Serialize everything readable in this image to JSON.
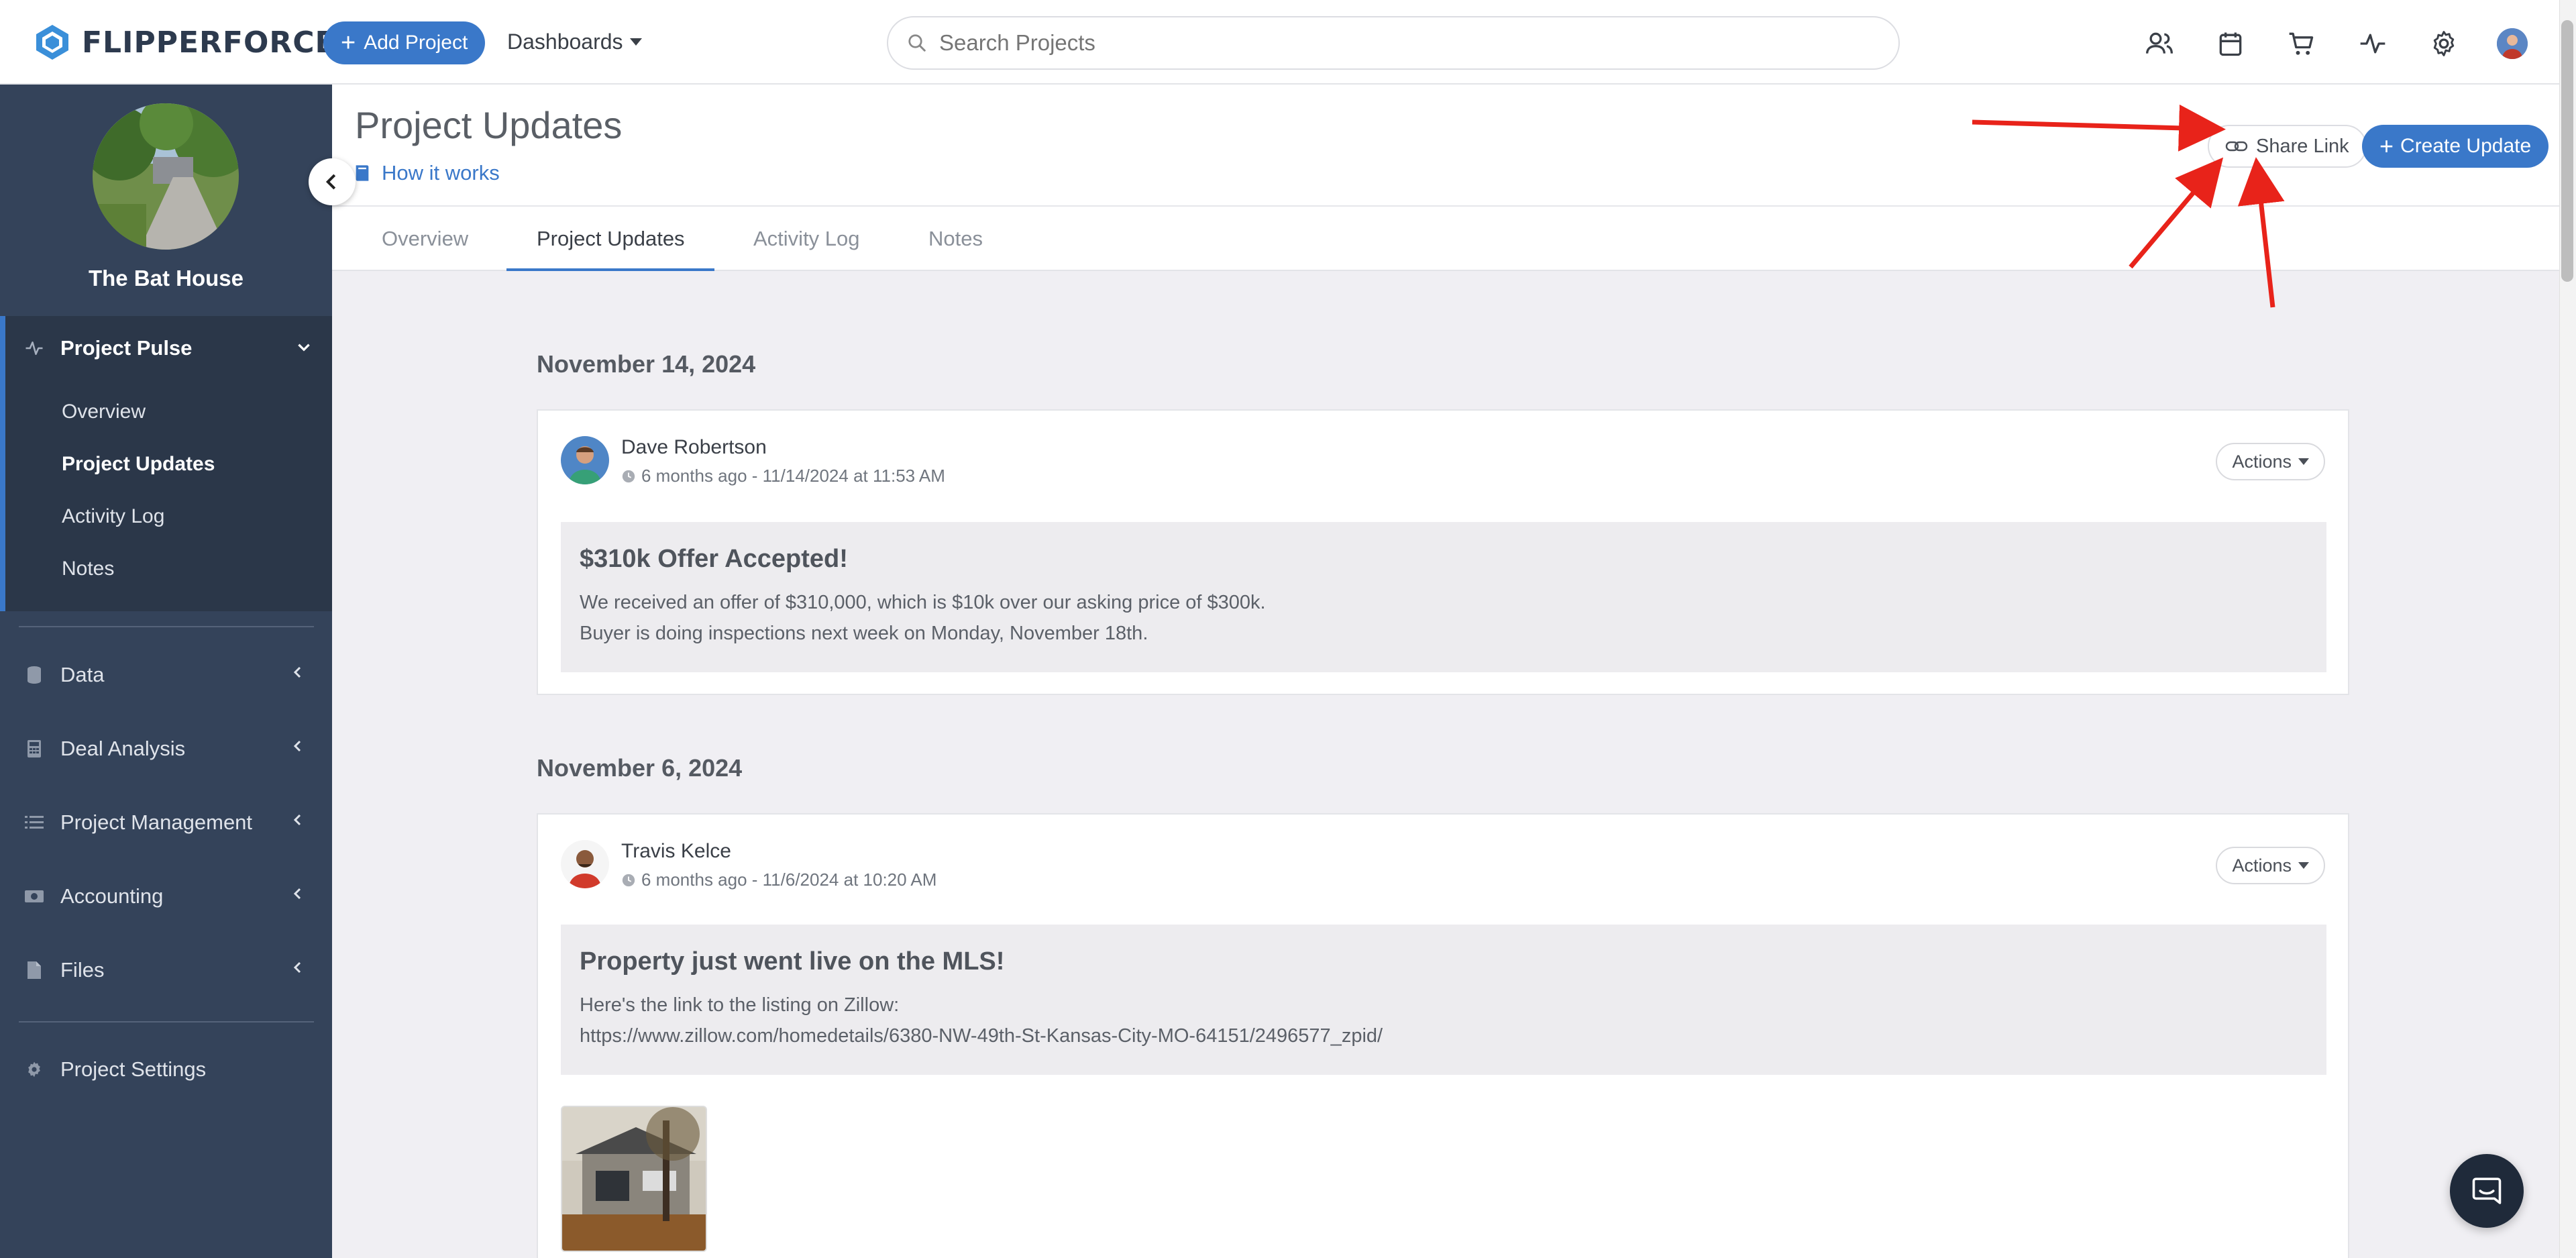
{
  "topbar": {
    "logo_text": "FLIPPERFORCE",
    "add_project_label": "Add Project",
    "dashboards_label": "Dashboards",
    "search_placeholder": "Search Projects",
    "icons": [
      "users-icon",
      "calendar-icon",
      "cart-icon",
      "pulse-icon",
      "gear-icon",
      "user-avatar"
    ]
  },
  "sidebar": {
    "project_name": "The Bat House",
    "pulse": {
      "label": "Project Pulse",
      "items": [
        "Overview",
        "Project Updates",
        "Activity Log",
        "Notes"
      ],
      "active": "Project Updates"
    },
    "sections": [
      {
        "label": "Data",
        "icon": "database-icon"
      },
      {
        "label": "Deal Analysis",
        "icon": "calculator-icon"
      },
      {
        "label": "Project Management",
        "icon": "list-icon"
      },
      {
        "label": "Accounting",
        "icon": "money-icon"
      },
      {
        "label": "Files",
        "icon": "file-icon"
      }
    ],
    "settings_label": "Project Settings"
  },
  "header": {
    "title": "Project Updates",
    "how_it_works": "How it works",
    "share_link_label": "Share Link",
    "create_update_label": "Create Update"
  },
  "tabs": [
    {
      "label": "Overview"
    },
    {
      "label": "Project Updates",
      "active": true
    },
    {
      "label": "Activity Log"
    },
    {
      "label": "Notes"
    }
  ],
  "updates": [
    {
      "date": "November 14, 2024",
      "author": "Dave Robertson",
      "meta": "6 months ago - 11/14/2024 at 11:53 AM",
      "actions_label": "Actions",
      "title": "$310k Offer Accepted!",
      "lines": [
        "We received an offer of $310,000, which is $10k over our asking price of $300k.",
        "Buyer is doing inspections next week on Monday, November 18th."
      ]
    },
    {
      "date": "November 6, 2024",
      "author": "Travis Kelce",
      "meta": "6 months ago - 11/6/2024 at 10:20 AM",
      "actions_label": "Actions",
      "title": "Property just went live on the MLS!",
      "lines": [
        "Here's the link to the listing on Zillow:",
        "https://www.zillow.com/homedetails/6380-NW-49th-St-Kansas-City-MO-64151/2496577_zpid/"
      ]
    }
  ],
  "colors": {
    "brand_blue": "#3a78c9",
    "sidebar_bg": "#34435a",
    "sidebar_active_bg": "#2b3749",
    "annotation_red": "#e8231a"
  }
}
